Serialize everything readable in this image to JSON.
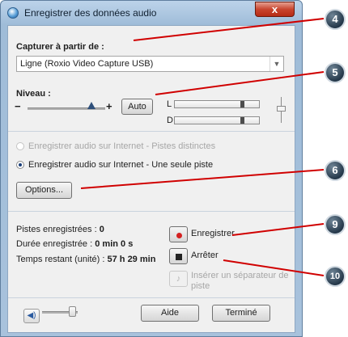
{
  "window": {
    "title": "Enregistrer des données audio",
    "close_glyph": "x"
  },
  "capture": {
    "label": "Capturer à partir de :",
    "selected": "Ligne (Roxio Video Capture USB)"
  },
  "level": {
    "label": "Niveau :",
    "minus": "−",
    "plus": "+",
    "auto_button": "Auto",
    "meter_left": "L",
    "meter_right": "D",
    "slider_position": 0.82,
    "left_meter_level": 0.82,
    "right_meter_level": 0.82
  },
  "record_options": {
    "option_multi": "Enregistrer audio sur Internet - Pistes distinctes",
    "option_single": "Enregistrer audio sur Internet - Une seule piste",
    "selected": "single",
    "options_button": "Options..."
  },
  "stats": {
    "tracks_label": "Pistes enregistrées :",
    "tracks_value": "0",
    "duration_label": "Durée enregistrée :",
    "duration_value": "0 min 0 s",
    "remaining_label": "Temps restant (unité) :",
    "remaining_value": "57 h 29 min"
  },
  "actions": {
    "record": "Enregistrer",
    "stop": "Arrêter",
    "separator_line1": "Insérer un séparateur de",
    "separator_line2": "piste"
  },
  "footer": {
    "help": "Aide",
    "done": "Terminé",
    "volume_level": 0.85
  },
  "callouts": [
    "4",
    "5",
    "6",
    "9",
    "10"
  ],
  "icons": {
    "app": "audio-app-icon",
    "speaker": "speaker-icon",
    "record": "record-icon",
    "stop": "stop-icon",
    "separator": "separator-icon"
  }
}
